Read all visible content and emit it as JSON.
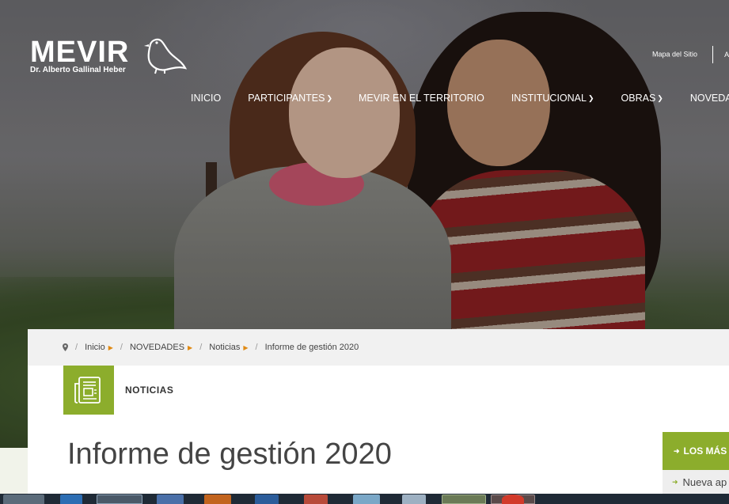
{
  "header": {
    "logo_text": "MEVIR",
    "logo_subtitle": "Dr. Alberto Gallinal Heber",
    "top_link": "Mapa del Sitio",
    "top_link_cut": "A"
  },
  "nav": {
    "items": [
      {
        "label": "INICIO",
        "dropdown": false
      },
      {
        "label": "PARTICIPANTES",
        "dropdown": true
      },
      {
        "label": "MEVIR EN EL TERRITORIO",
        "dropdown": false
      },
      {
        "label": "INSTITUCIONAL",
        "dropdown": true
      },
      {
        "label": "OBRAS",
        "dropdown": true
      },
      {
        "label": "NOVEDADES",
        "dropdown": true
      }
    ]
  },
  "breadcrumb": {
    "items": [
      "Inicio",
      "NOVEDADES",
      "Noticias",
      "Informe de gestión 2020"
    ]
  },
  "section": {
    "label": "NOTICIAS"
  },
  "page": {
    "title": "Informe de gestión 2020"
  },
  "sidebar": {
    "heading": "LOS MÁS",
    "item": "Nueva ap"
  },
  "colors": {
    "accent_green": "#8cad2c",
    "breadcrumb_arrow": "#e08a14",
    "taskbar": "#1f2a36"
  },
  "icons": [
    "location-pin-icon",
    "newspaper-icon",
    "chevron-down-icon",
    "arrow-right-icon",
    "bird-logo-icon"
  ]
}
